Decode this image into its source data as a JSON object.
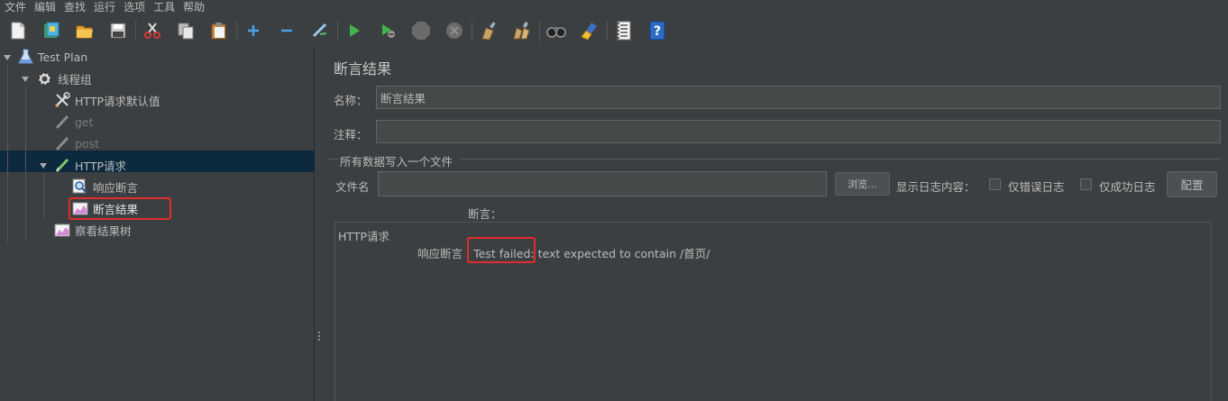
{
  "menu": [
    "文件",
    "编辑",
    "查找",
    "运行",
    "选项",
    "工具",
    "帮助"
  ],
  "toolbar": {
    "icons": [
      "new-icon",
      "templates-icon",
      "open-icon",
      "save-icon",
      "cut-icon",
      "copy-icon",
      "paste-icon",
      "expand-icon",
      "collapse-icon",
      "toggle-icon",
      "start-icon",
      "start-no-pause-icon",
      "stop-icon",
      "shutdown-icon",
      "clear-icon",
      "clear-all-icon",
      "search-icon",
      "reset-search-icon",
      "function-helper-icon",
      "help-icon"
    ]
  },
  "tree": {
    "test_plan": "Test Plan",
    "thread_group": "线程组",
    "http_defaults": "HTTP请求默认值",
    "get": "get",
    "post": "post",
    "http_request": "HTTP请求",
    "response_assertion": "响应断言",
    "assertion_results": "断言结果",
    "view_results_tree": "察看结果树"
  },
  "panel": {
    "title": "断言结果",
    "name_label": "名称：",
    "name_value": "断言结果",
    "comment_label": "注释：",
    "comment_value": "",
    "file_group_title": "所有数据写入一个文件",
    "filename_label": "文件名",
    "filename_value": "",
    "browse_button": "浏览...",
    "log_display_label": "显示日志内容：",
    "errors_only_label": "仅错误日志",
    "successes_only_label": "仅成功日志",
    "configure_button": "配置",
    "assertion_header": "断言：",
    "result_sampler": "HTTP请求",
    "result_assertion_name": "响应断言",
    "result_failed": " : Test failed:",
    "result_message": " text expected to contain /首页/"
  },
  "colors": {
    "background": "#3c3f41",
    "selection": "#0d293e",
    "highlight_border": "#e12d2d",
    "text": "#bbbbbb"
  }
}
